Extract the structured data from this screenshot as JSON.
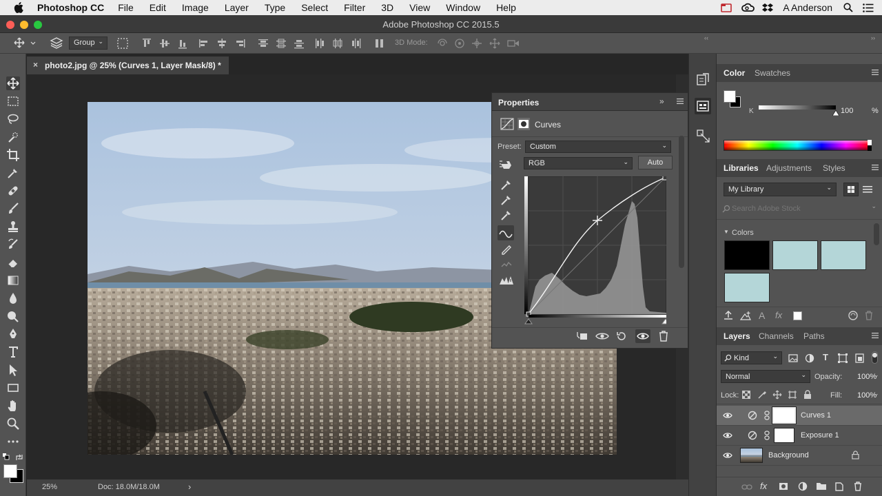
{
  "menubar": {
    "app": "Photoshop CC",
    "items": [
      "File",
      "Edit",
      "Image",
      "Layer",
      "Type",
      "Select",
      "Filter",
      "3D",
      "View",
      "Window",
      "Help"
    ],
    "user": "A Anderson"
  },
  "window": {
    "title": "Adobe Photoshop CC 2015.5"
  },
  "options": {
    "auto_select": "Group",
    "mode_3d": "3D Mode:"
  },
  "document": {
    "tab_title": "photo2.jpg @ 25% (Curves 1, Layer Mask/8) *",
    "zoom": "25%",
    "doc_info": "Doc: 18.0M/18.0M"
  },
  "properties": {
    "title": "Properties",
    "adjustment": "Curves",
    "preset_label": "Preset:",
    "preset_value": "Custom",
    "channel": "RGB",
    "auto_label": "Auto"
  },
  "color_panel": {
    "tabs": [
      "Color",
      "Swatches"
    ],
    "channel_label": "K",
    "value": "100",
    "unit": "%",
    "k_level_percent": 100
  },
  "libraries": {
    "tabs": [
      "Libraries",
      "Adjustments",
      "Styles"
    ],
    "library": "My Library",
    "search_placeholder": "Search Adobe Stock",
    "colors_label": "Colors",
    "swatches": [
      "#000000",
      "#b4d6d8",
      "#b4d6d8",
      "#b4d6d8"
    ]
  },
  "layers_panel": {
    "tabs": [
      "Layers",
      "Channels",
      "Paths"
    ],
    "filter": "Kind",
    "blend_mode": "Normal",
    "opacity_label": "Opacity:",
    "opacity": "100%",
    "lock_label": "Lock:",
    "fill_label": "Fill:",
    "fill": "100%",
    "layers": [
      {
        "name": "Curves 1",
        "selected": true
      },
      {
        "name": "Exposure 1",
        "selected": false
      },
      {
        "name": "Background",
        "selected": false
      }
    ]
  }
}
